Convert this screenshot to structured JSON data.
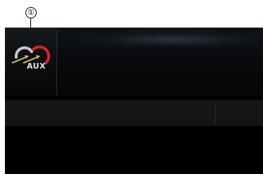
{
  "callout": {
    "number": "①"
  },
  "source": {
    "label": "AUX",
    "icon": "aux-source-icon"
  },
  "colors": {
    "accent_red": "#e02020",
    "arrow_yellow": "#d9c04a"
  }
}
